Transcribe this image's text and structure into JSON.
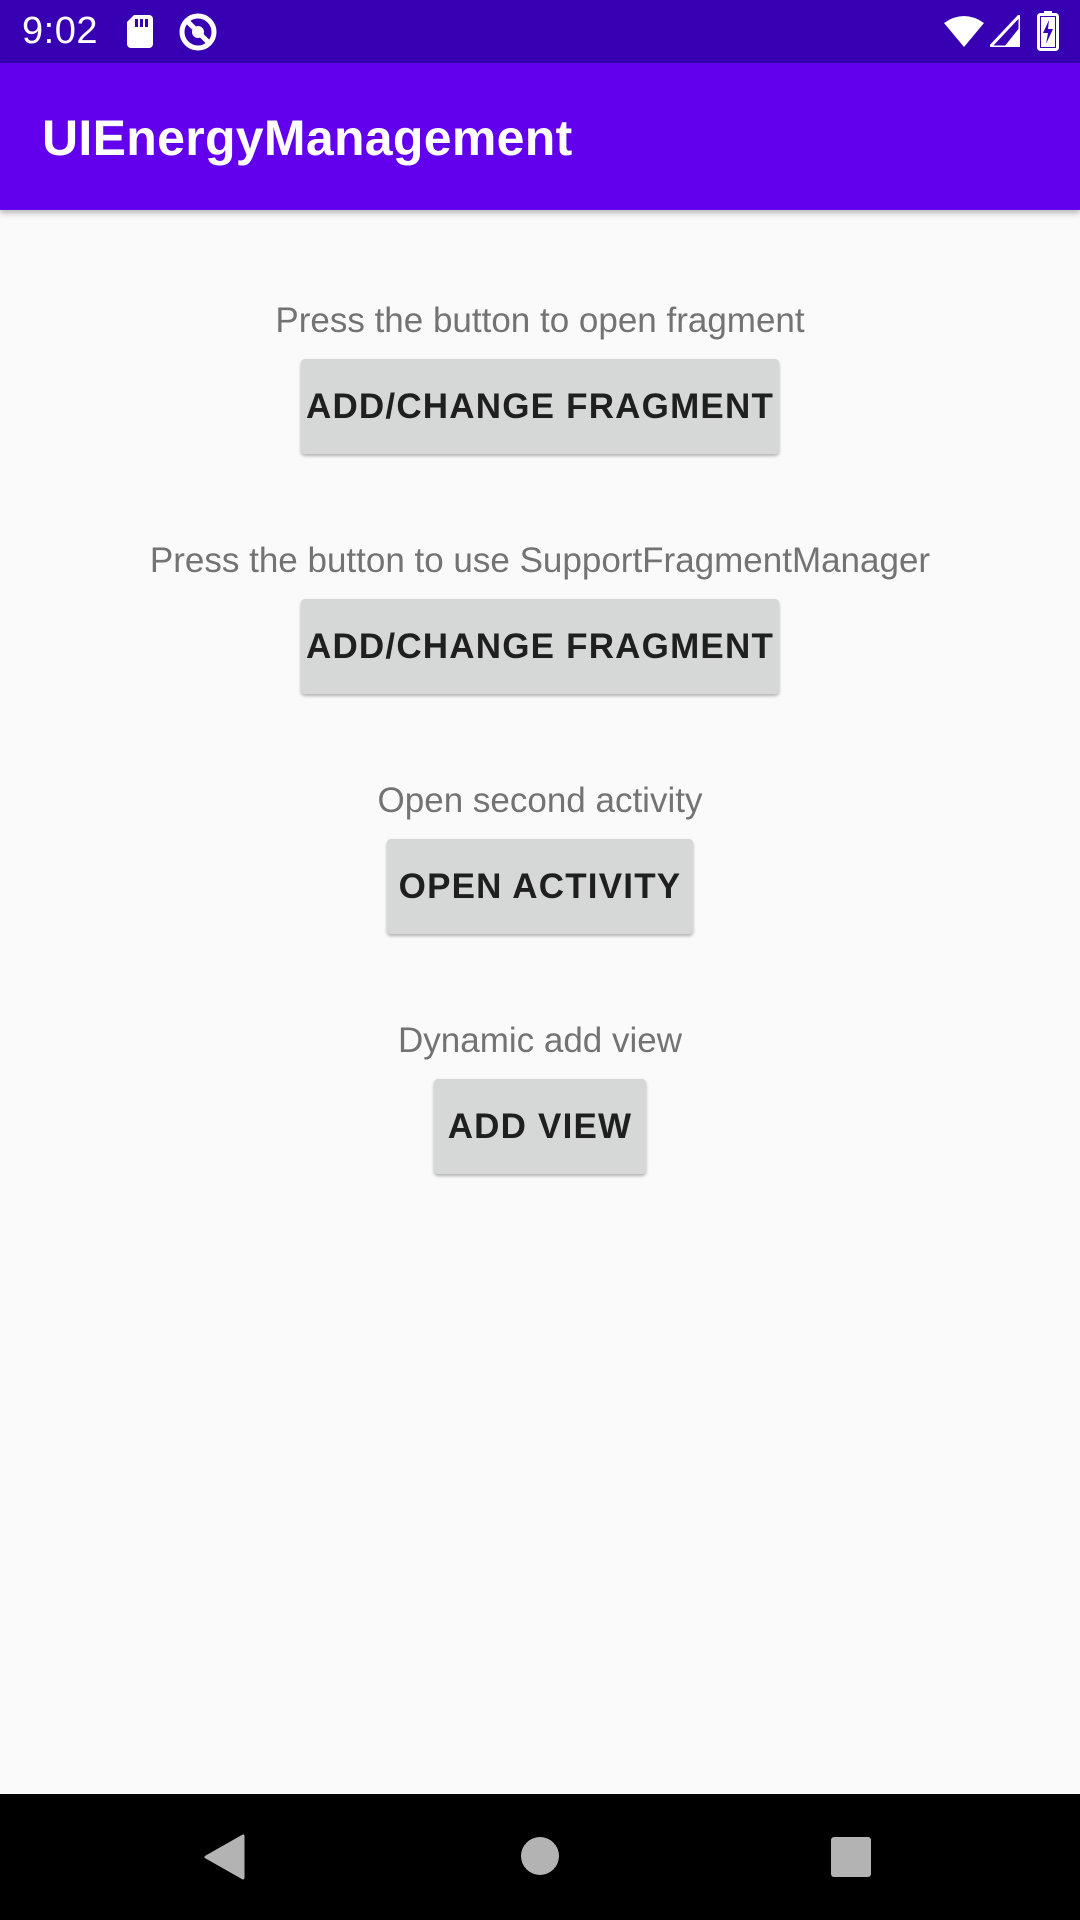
{
  "status_bar": {
    "time": "9:02",
    "icons": [
      "sd-card-icon",
      "do-not-disturb-icon",
      "wifi-icon",
      "signal-icon",
      "battery-charging-icon"
    ]
  },
  "app_bar": {
    "title": "UIEnergyManagement",
    "color": "#6200ee",
    "status_color": "#3700b3"
  },
  "main": {
    "sections": [
      {
        "label": "Press the button to open fragment",
        "button": "ADD/CHANGE FRAGMENT"
      },
      {
        "label": "Press the button to use SupportFragmentManager",
        "button": "ADD/CHANGE FRAGMENT"
      },
      {
        "label": "Open second activity",
        "button": "OPEN ACTIVITY"
      },
      {
        "label": "Dynamic add view",
        "button": "ADD VIEW"
      }
    ]
  },
  "nav_bar": {
    "buttons": [
      "back-icon",
      "home-icon",
      "recents-icon"
    ]
  }
}
